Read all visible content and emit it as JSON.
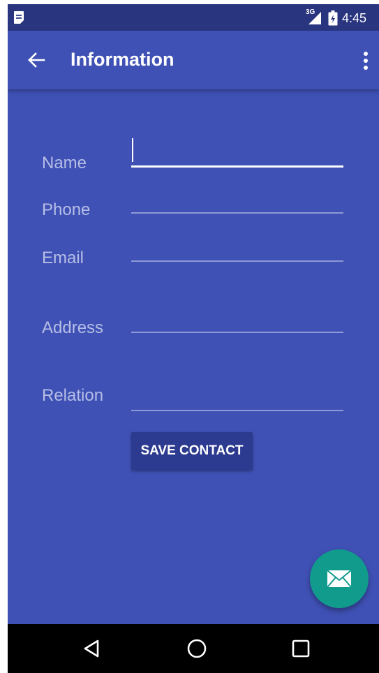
{
  "status_bar": {
    "network": "3G",
    "time": "4:45",
    "left_icon": "notification-icon"
  },
  "app_bar": {
    "title": "Information",
    "back_icon": "arrow-back-icon",
    "menu_icon": "more-vert-icon"
  },
  "form": {
    "fields": [
      {
        "label": "Name",
        "value": "",
        "active": true
      },
      {
        "label": "Phone",
        "value": ""
      },
      {
        "label": "Email",
        "value": ""
      },
      {
        "label": "Address",
        "value": ""
      },
      {
        "label": "Relation",
        "value": ""
      }
    ],
    "save_label": "SAVE CONTACT"
  },
  "fab": {
    "icon": "email-icon"
  },
  "nav_bar": {
    "back_icon": "nav-back-icon",
    "home_icon": "nav-home-icon",
    "recents_icon": "nav-recents-icon"
  },
  "colors": {
    "primary": "#3F51B5",
    "status_bar": "#2A3580",
    "accent": "#119B8C",
    "button": "#2C3A8F"
  }
}
